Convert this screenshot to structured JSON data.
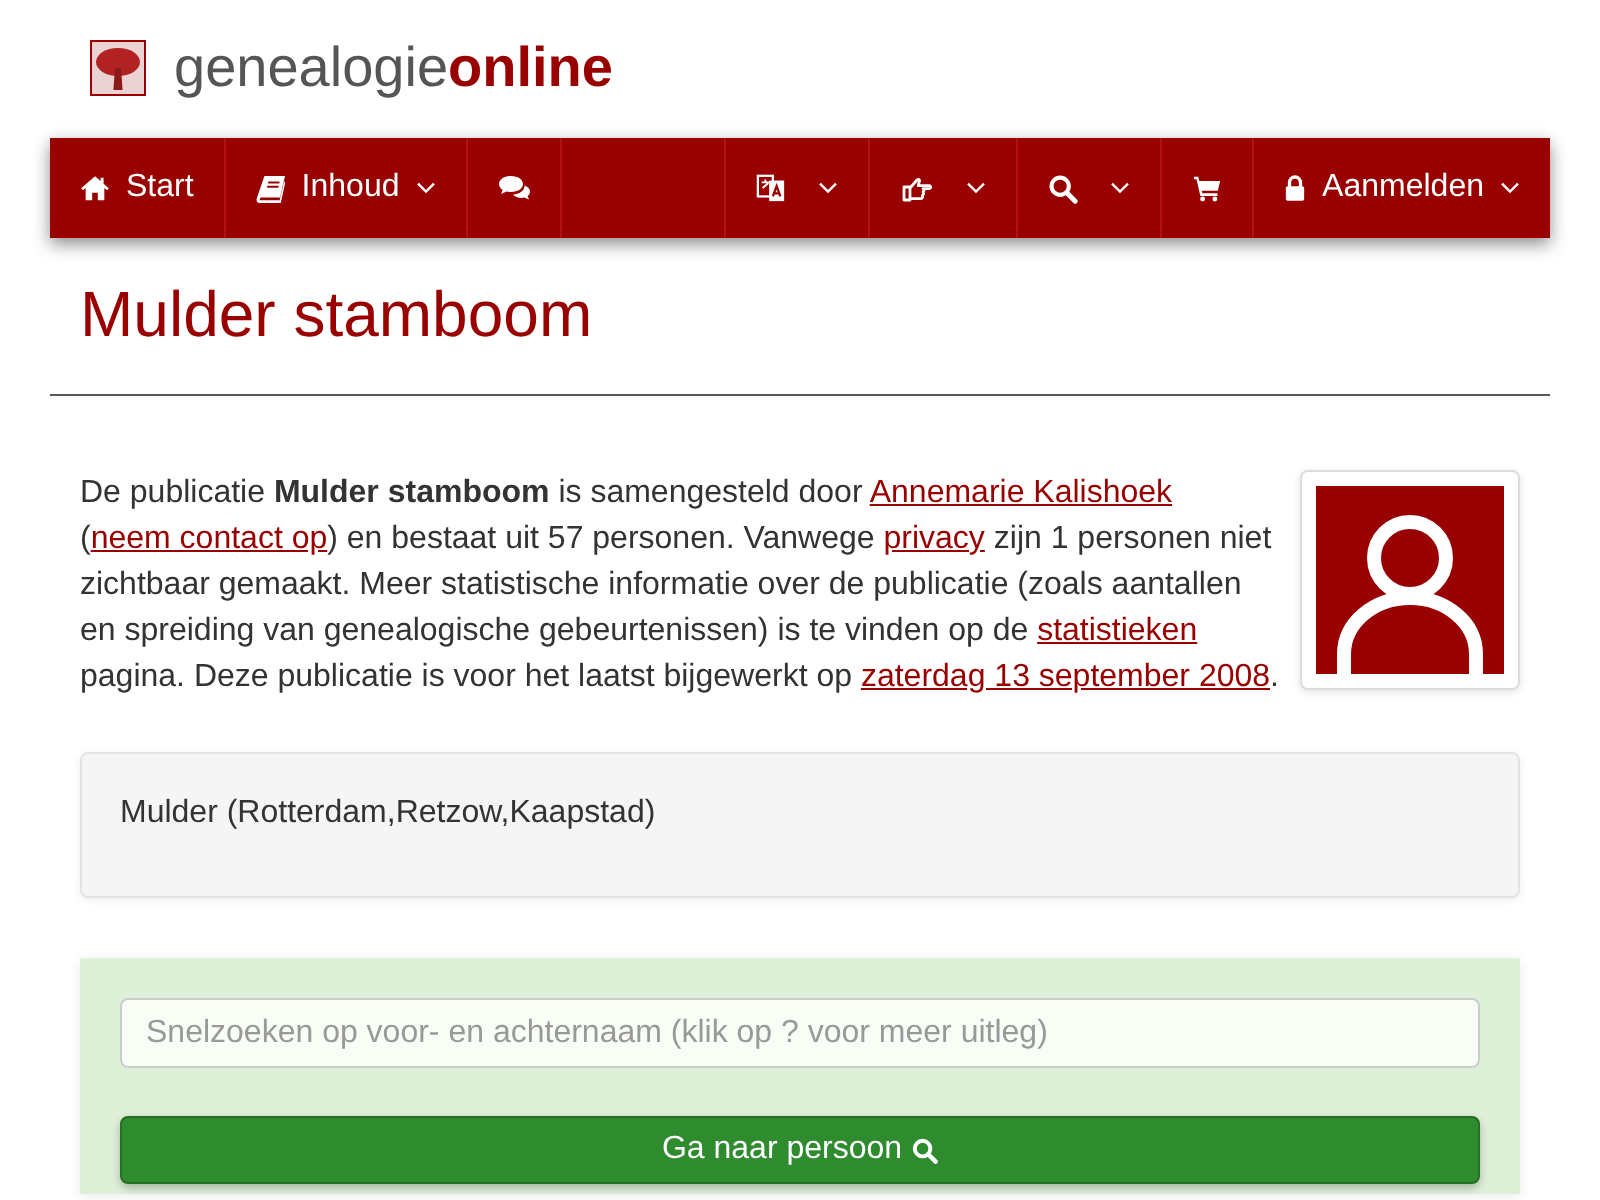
{
  "logo": {
    "text": "genealogie**online**"
  },
  "nav": {
    "left": [
      {
        "label": "Start",
        "dropdown": false
      },
      {
        "label": "Inhoud",
        "dropdown": true
      },
      {
        "dropdown": false
      }
    ],
    "right": [
      {
        "dropdown": true
      },
      {
        "dropdown": true
      },
      {
        "dropdown": true
      },
      {
        "dropdown": false
      },
      {
        "label": "Aanmelden",
        "dropdown": true
      }
    ]
  },
  "title": "Mulder stamboom",
  "intro": [
    {
      "kind": "text",
      "text": "De publicatie **Mulder stamboom** is samengesteld door "
    },
    {
      "kind": "link",
      "text": "Annemarie Kalishoek"
    },
    {
      "kind": "text",
      "text": " ("
    },
    {
      "kind": "link",
      "text": "neem contact op"
    },
    {
      "kind": "text",
      "text": ") en bestaat uit 57 personen. Vanwege "
    },
    {
      "kind": "link",
      "text": "privacy"
    },
    {
      "kind": "text",
      "text": " zijn 1 personen niet zichtbaar gemaakt. Meer statistische informatie over de publicatie (zoals aantallen en spreiding van genealogische gebeurtenissen) is te vinden op de "
    },
    {
      "kind": "link",
      "text": "statistieken"
    },
    {
      "kind": "text",
      "text": " pagina. Deze publicatie is voor het laatst bijgewerkt op "
    },
    {
      "kind": "link",
      "text": "zaterdag 13 september 2008"
    },
    {
      "kind": "text",
      "text": "."
    }
  ],
  "family_summary": "Mulder (Rotterdam,Retzow,Kaapstad)",
  "quick_search": {
    "placeholder": "Snelzoeken op voor- en achternaam (klik op ? voor meer uitleg)",
    "button": "Ga naar persoon"
  }
}
